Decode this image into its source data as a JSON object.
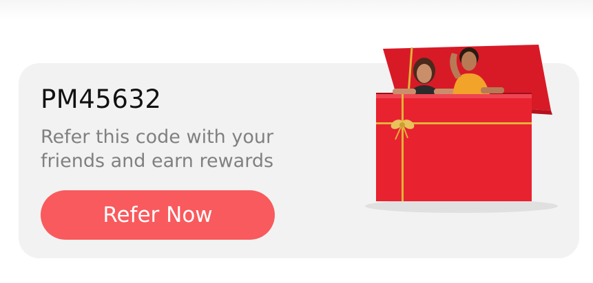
{
  "referral": {
    "code": "PM45632",
    "description": "Refer this code with your friends and earn rewards",
    "button_label": "Refer Now"
  },
  "illustration": {
    "icon": "gift-box-with-people-icon",
    "box_color": "#e8222f",
    "ribbon_color": "#e3b33b"
  },
  "theme": {
    "accent": "#f95a5d",
    "card_background": "#f2f2f2"
  }
}
